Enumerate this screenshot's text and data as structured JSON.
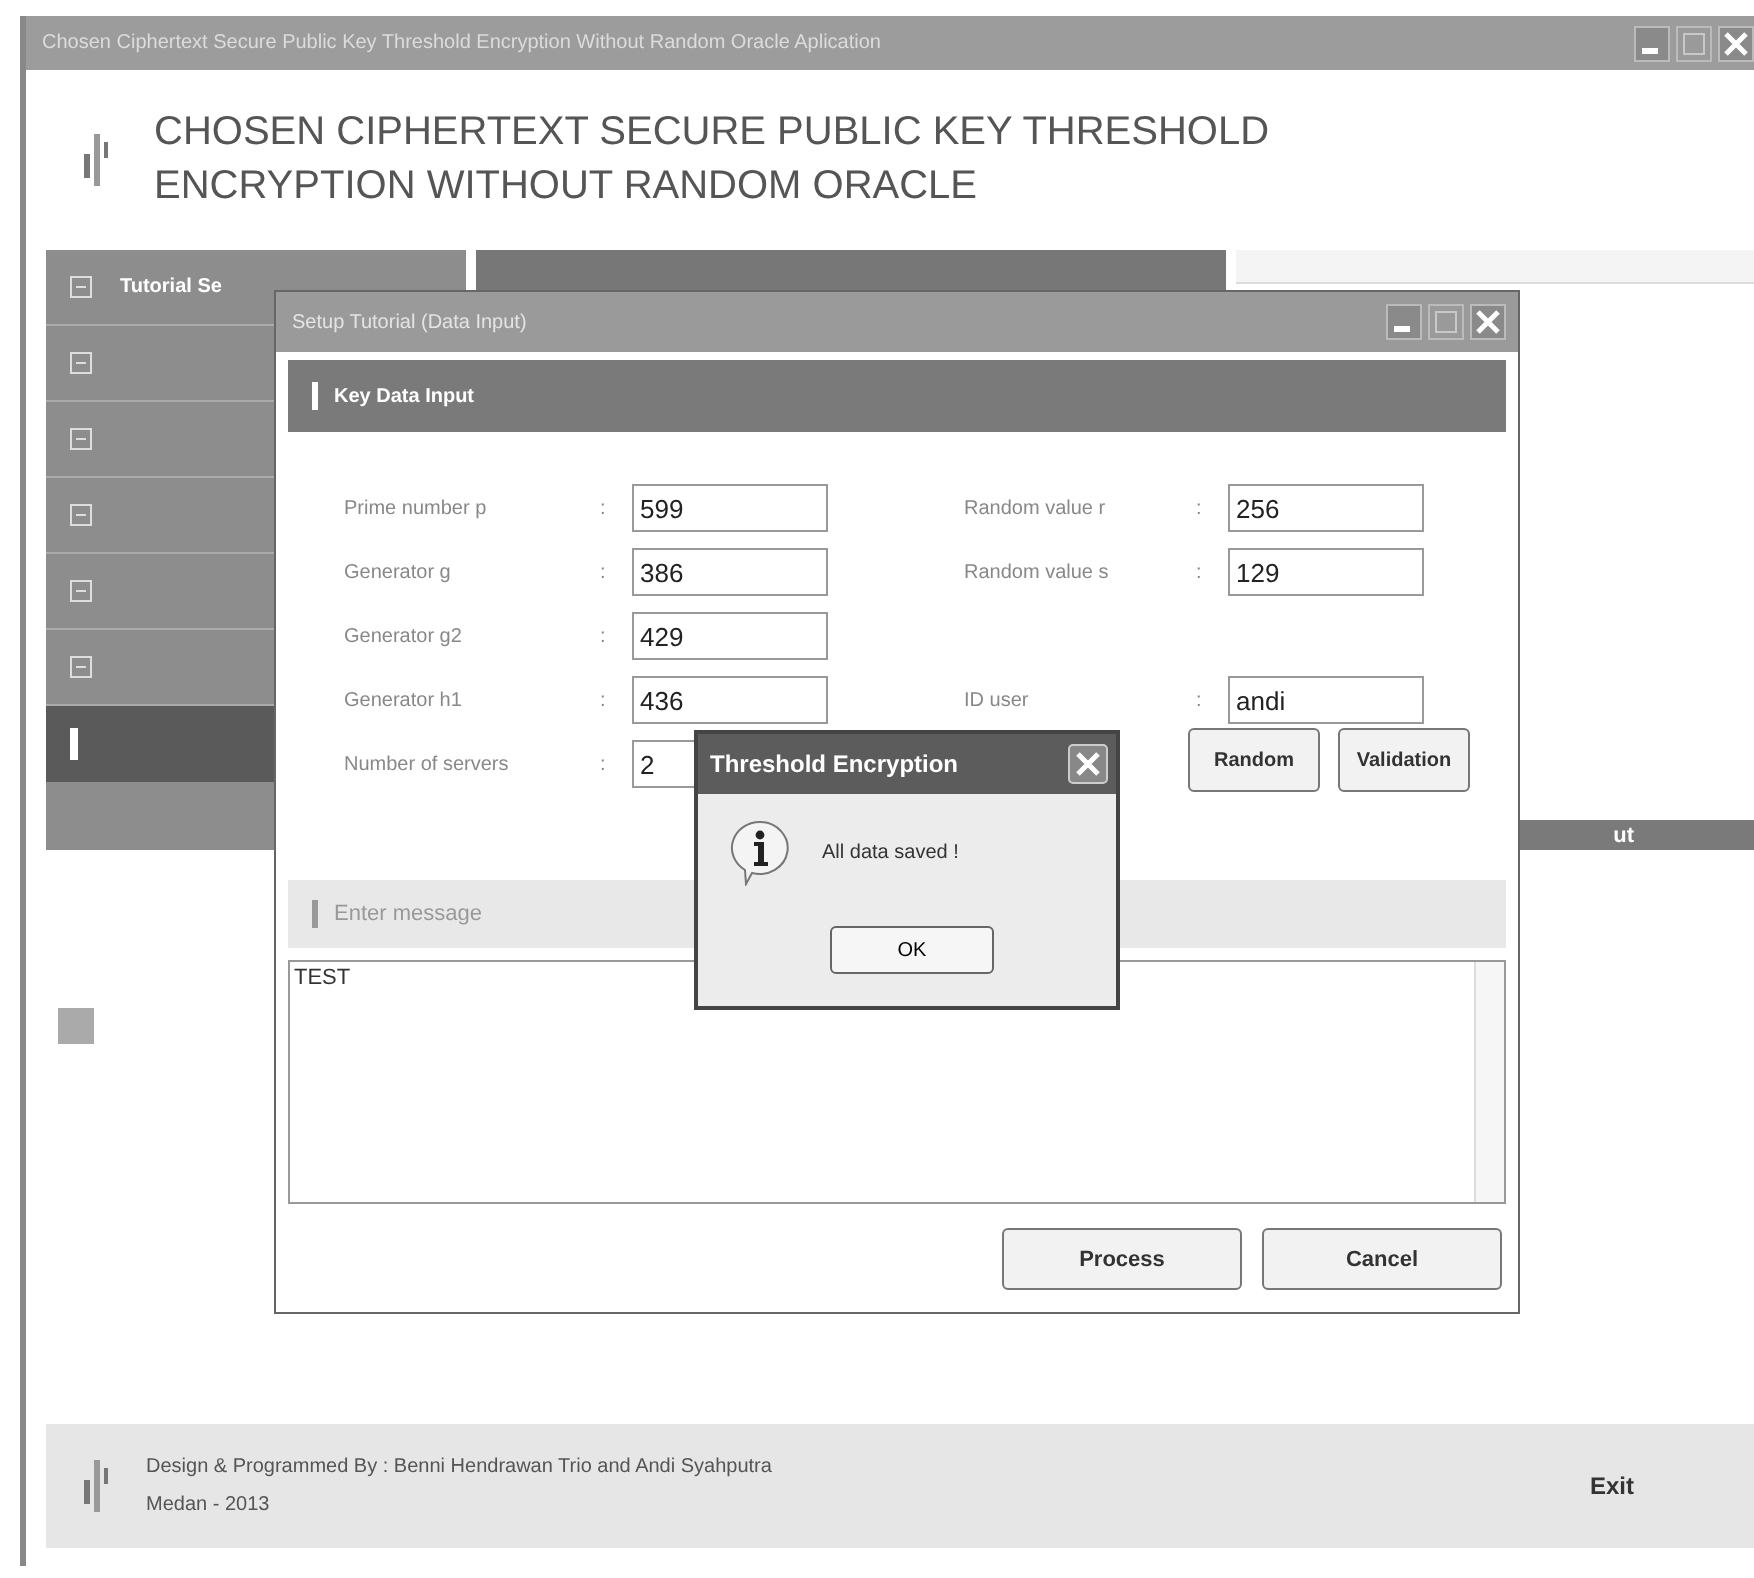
{
  "app": {
    "title": "Chosen Ciphertext Secure Public Key Threshold Encryption Without Random Oracle Aplication",
    "heading": "CHOSEN CIPHERTEXT SECURE PUBLIC KEY THRESHOLD ENCRYPTION WITHOUT RANDOM ORACLE"
  },
  "sidebar": {
    "items": [
      {
        "kind": "labeled",
        "label": "Tutorial Se"
      },
      {
        "kind": "blurred"
      },
      {
        "kind": "blurred"
      },
      {
        "kind": "blurred"
      },
      {
        "kind": "blurred"
      },
      {
        "kind": "blurred"
      },
      {
        "kind": "active"
      }
    ]
  },
  "right_panel": {
    "header": "ut"
  },
  "dialog": {
    "title": "Setup Tutorial (Data Input)",
    "section": "Key Data Input",
    "left_fields": [
      {
        "label": "Prime number p",
        "sep": ":",
        "value": "599"
      },
      {
        "label": "Generator g",
        "sep": ":",
        "value": "386"
      },
      {
        "label": "Generator g2",
        "sep": ":",
        "value": "429"
      },
      {
        "label": "Generator h1",
        "sep": ":",
        "value": "436"
      },
      {
        "label": "Number of servers",
        "sep": ":",
        "value": "2"
      }
    ],
    "right_fields": [
      {
        "label": "Random value r",
        "sep": ":",
        "value": "256"
      },
      {
        "label": "Random value s",
        "sep": ":",
        "value": "129"
      },
      {
        "kind": "gap"
      },
      {
        "label": "ID user",
        "sep": ":",
        "value": "andi"
      }
    ],
    "buttons": [
      "Random",
      "Validation"
    ],
    "message_section": "Enter message",
    "message": "TEST",
    "actions": [
      "Process",
      "Cancel"
    ]
  },
  "alert": {
    "title": "Threshold Encryption",
    "text": "All data saved !",
    "button": "OK"
  },
  "footer": {
    "credit": "Design & Programmed By :  Benni Hendrawan Trio and Andi Syahputra",
    "place": "Medan - 2013",
    "exit": "Exit"
  }
}
